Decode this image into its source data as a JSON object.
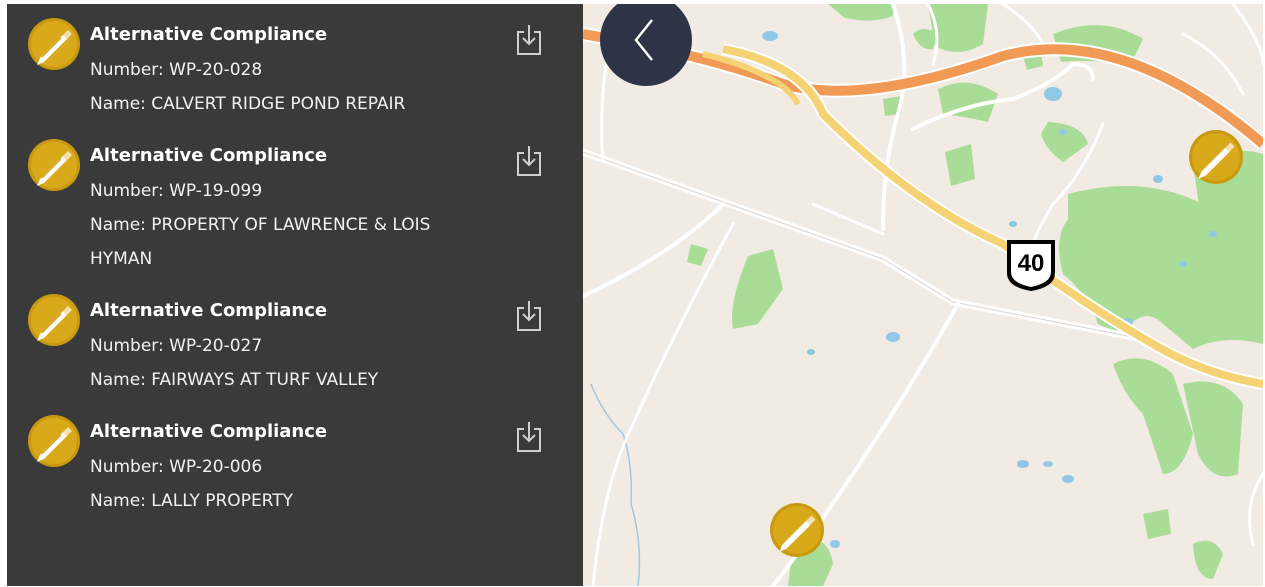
{
  "results": [
    {
      "type_label": "Alternative Compliance",
      "number_line": "Number: WP-20-028",
      "name_line1": "Name: CALVERT RIDGE POND REPAIR",
      "name_line2": ""
    },
    {
      "type_label": "Alternative Compliance",
      "number_line": "Number: WP-19-099",
      "name_line1": "Name: PROPERTY OF LAWRENCE & LOIS",
      "name_line2": "HYMAN"
    },
    {
      "type_label": "Alternative Compliance",
      "number_line": "Number: WP-20-027",
      "name_line1": "Name: FAIRWAYS AT TURF VALLEY",
      "name_line2": ""
    },
    {
      "type_label": "Alternative Compliance",
      "number_line": "Number: WP-20-006",
      "name_line1": "Name: LALLY PROPERTY",
      "name_line2": ""
    }
  ],
  "icons": {
    "result_badge": "pen-icon",
    "download": "download-icon",
    "collapse": "chevron-left-icon",
    "marker": "pen-marker-icon"
  },
  "colors": {
    "panel_bg": "#3a3a3a",
    "badge_gold": "#c99a10",
    "collapse_button": "#2e3447",
    "map_land": "#f1ebe4",
    "park_green": "#a9dc96",
    "water_blue": "#90c8e6",
    "highway_orange": "#f19a55",
    "highway_yellow": "#f5d374"
  },
  "map": {
    "route_shield": "40"
  }
}
